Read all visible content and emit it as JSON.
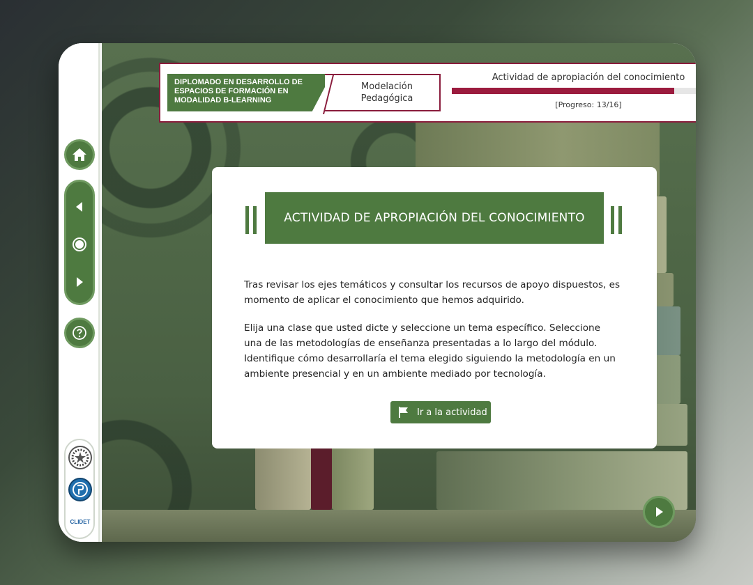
{
  "header": {
    "program_name": "DIPLOMADO EN DESARROLLO DE ESPACIOS DE FORMACIÓN EN MODALIDAD B-LEARNING",
    "module": "Modelación Pedagógica",
    "section_title": "Actividad de apropiación del conocimiento",
    "progress_label": "[Progreso: 13/16]",
    "progress_value": 0.8125
  },
  "card": {
    "heading": "ACTIVIDAD DE APROPIACIÓN DEL CONOCIMIENTO",
    "paragraph1": "Tras revisar los ejes temáticos y consultar los recursos de apoyo dispuestos, es momento de aplicar el conocimiento que hemos adquirido.",
    "paragraph2": "Elija una clase que usted dicte y seleccione un tema específico. Seleccione una de las metodologías de enseñanza presentadas a lo largo del módulo. Identifique cómo desarrollaría el tema elegido siguiendo la metodología en un ambiente presencial y en un ambiente mediado por tecnología.",
    "button_label": "Ir a la actividad"
  },
  "sidebar": {
    "icons": [
      "home-icon",
      "previous-icon",
      "center-icon",
      "next-icon",
      "help-icon"
    ],
    "logos": [
      "institution-seal-logo",
      "university-logo",
      "clidet-logo"
    ],
    "clidet_text": "CLIDET"
  },
  "colors": {
    "brand_green": "#4e7a40",
    "accent_burgundy": "#8a1c3c",
    "progress_fill": "#9b1b3e"
  }
}
